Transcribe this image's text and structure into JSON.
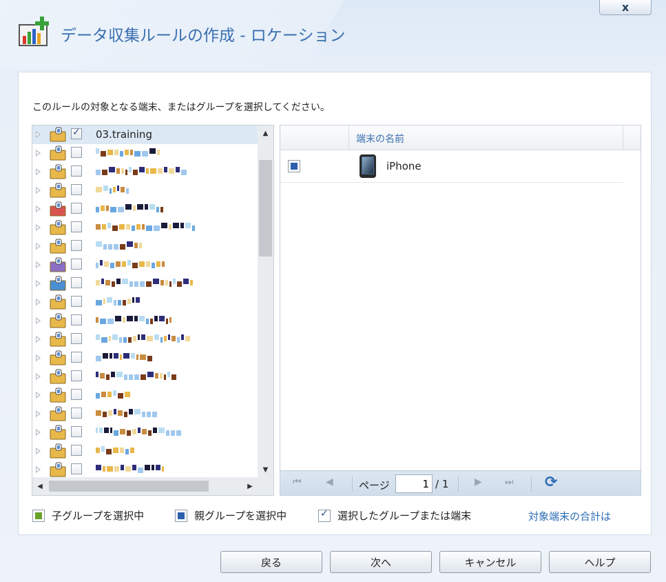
{
  "window": {
    "title": "データ収集ルールの作成 - ロケーション",
    "close_label": "x"
  },
  "instruction": "このルールの対象となる端末、またはグループを選択してください。",
  "tree": {
    "rows": [
      {
        "label": "03.training",
        "checked": true,
        "icon": "folder-group-icon",
        "selected": true
      },
      {
        "label": "",
        "checked": false,
        "icon": "folder-group-icon"
      },
      {
        "label": "",
        "checked": false,
        "icon": "folder-group-icon"
      },
      {
        "label": "",
        "checked": false,
        "icon": "folder-group-icon"
      },
      {
        "label": "",
        "checked": false,
        "icon": "folder-group-red-icon"
      },
      {
        "label": "",
        "checked": false,
        "icon": "folder-group-icon"
      },
      {
        "label": "",
        "checked": false,
        "icon": "folder-group-icon"
      },
      {
        "label": "",
        "checked": false,
        "icon": "folder-group-purple-icon"
      },
      {
        "label": "",
        "checked": false,
        "icon": "folder-group-blue-icon"
      },
      {
        "label": "",
        "checked": false,
        "icon": "folder-group-icon"
      },
      {
        "label": "",
        "checked": false,
        "icon": "folder-group-icon"
      },
      {
        "label": "",
        "checked": false,
        "icon": "folder-group-icon"
      },
      {
        "label": "",
        "checked": false,
        "icon": "folder-group-icon"
      },
      {
        "label": "",
        "checked": false,
        "icon": "folder-group-icon"
      },
      {
        "label": "",
        "checked": false,
        "icon": "folder-group-icon"
      },
      {
        "label": "",
        "checked": false,
        "icon": "folder-group-icon"
      },
      {
        "label": "",
        "checked": false,
        "icon": "folder-group-icon"
      },
      {
        "label": "",
        "checked": false,
        "icon": "folder-group-icon"
      },
      {
        "label": "",
        "checked": false,
        "icon": "folder-group-icon"
      }
    ]
  },
  "grid": {
    "column_header": "端末の名前",
    "rows": [
      {
        "name": "iPhone",
        "icon": "iphone-icon"
      }
    ]
  },
  "pager": {
    "page_label": "ページ",
    "current_page": "1",
    "total_pages": "/ 1"
  },
  "legend": {
    "child_selected": "子グループを選択中",
    "parent_selected": "親グループを選択中",
    "selected_items": "選択したグループまたは端末",
    "total_link": "対象端末の合計は"
  },
  "buttons": {
    "back": "戻る",
    "next": "次へ",
    "cancel": "キャンセル",
    "help": "ヘルプ"
  },
  "colors": {
    "accent": "#3a6fb0",
    "child_indicator": "#6aa12a",
    "parent_indicator": "#2d5fae"
  }
}
